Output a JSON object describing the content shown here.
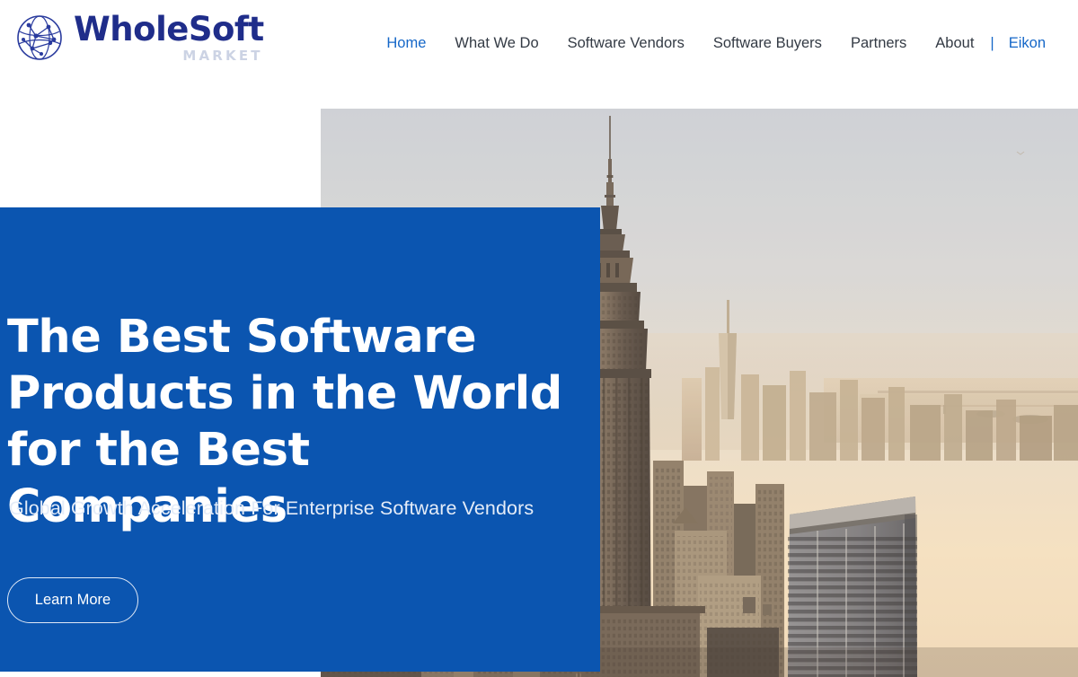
{
  "brand": {
    "name": "WholeSoft",
    "subtitle": "MARKET",
    "logo_icon": "globe-network-icon",
    "name_color": "#1f2d8a",
    "subtitle_color": "#ccd3e4"
  },
  "nav": {
    "items": [
      {
        "label": "Home",
        "state": "active"
      },
      {
        "label": "What We Do",
        "state": "default"
      },
      {
        "label": "Software Vendors",
        "state": "default"
      },
      {
        "label": "Software Buyers",
        "state": "default"
      },
      {
        "label": "Partners",
        "state": "default"
      },
      {
        "label": "About",
        "state": "default"
      }
    ],
    "separator": "|",
    "accent_item": {
      "label": "Eikon"
    },
    "active_color": "#1567c8",
    "default_color": "#333a44"
  },
  "hero": {
    "title": "The Best Software\nProducts in the World\nfor the Best Companies",
    "title_lines": [
      "The Best Software",
      "Products in the World",
      "for the Best Companies"
    ],
    "subtitle": "Global Growth Acceleration For Enterprise Software Vendors",
    "cta_label": "Learn More",
    "panel_color": "#0b55b0",
    "title_color": "#ffffff",
    "subtitle_color": "#e4ecf8",
    "photo_alt": "new-york-city-skyline-photo",
    "photo_description": "Aerial sunset view of the Manhattan skyline with the Empire State Building at center"
  }
}
